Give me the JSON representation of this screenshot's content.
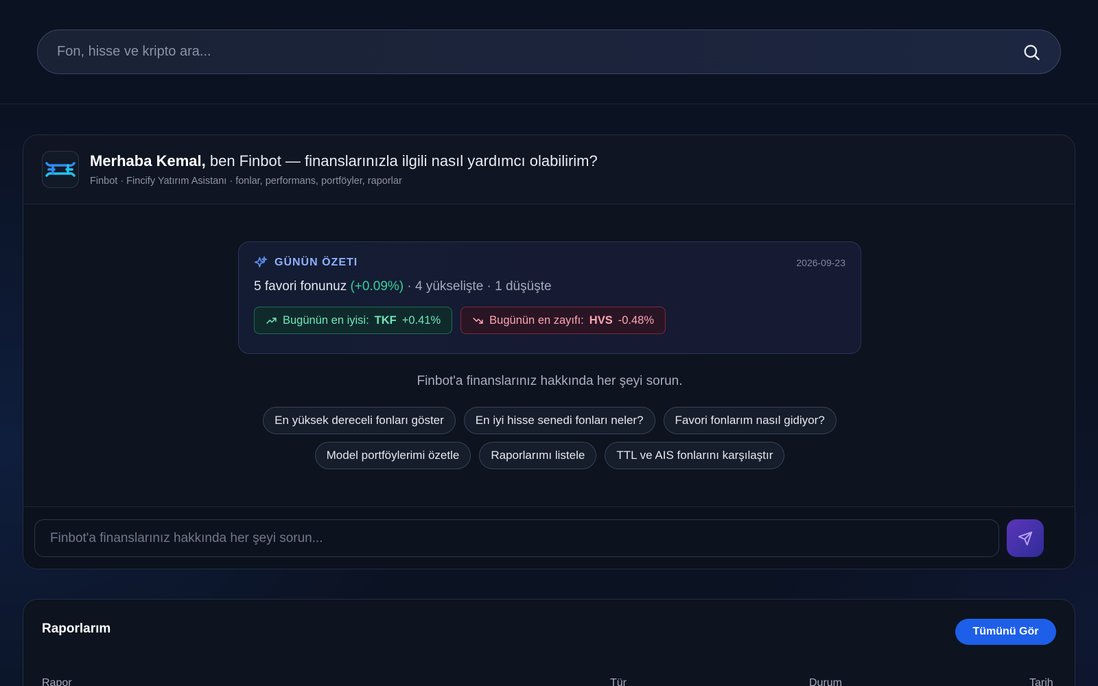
{
  "search": {
    "placeholder": "Fon, hisse ve kripto ara..."
  },
  "chat": {
    "greeting_name": "Merhaba Kemal,",
    "greeting_text": " ben Finbot — finanslarınızla ilgili nasıl yardımcı olabilirim?",
    "subtitle": "Finbot · Fincify Yatırım Asistanı · fonlar, performans, portföyler, raporlar",
    "summary": {
      "title": "GÜNÜN ÖZETI",
      "date": "2026-09-23",
      "favorites_text": "5 favori fonunuz ",
      "favorites_change": "(+0.09%)",
      "favorites_stats": " · 4 yükselişte · 1 düşüşte",
      "best": {
        "label": "Bugünün en iyisi:",
        "symbol": "TKF",
        "change": "+0.41%"
      },
      "worst": {
        "label": "Bugünün en zayıfı:",
        "symbol": "HVS",
        "change": "-0.48%"
      }
    },
    "hint": "Finbot'a finanslarınız hakkında her şeyi sorun.",
    "suggestions": [
      "En yüksek dereceli fonları göster",
      "En iyi hisse senedi fonları neler?",
      "Favori fonlarım nasıl gidiyor?",
      "Model portföylerimi özetle",
      "Raporlarımı listele",
      "TTL ve AIS fonlarını karşılaştır"
    ],
    "composer_placeholder": "Finbot'a finanslarınız hakkında her şeyi sorun..."
  },
  "reports": {
    "title": "Raporlarım",
    "view_all": "Tümünü Gör",
    "columns": [
      "Rapor",
      "Tür",
      "Durum",
      "Tarih"
    ]
  },
  "colors": {
    "accent": "#1d5fe8",
    "positive": "#34d399",
    "negative": "#fca5b5"
  }
}
